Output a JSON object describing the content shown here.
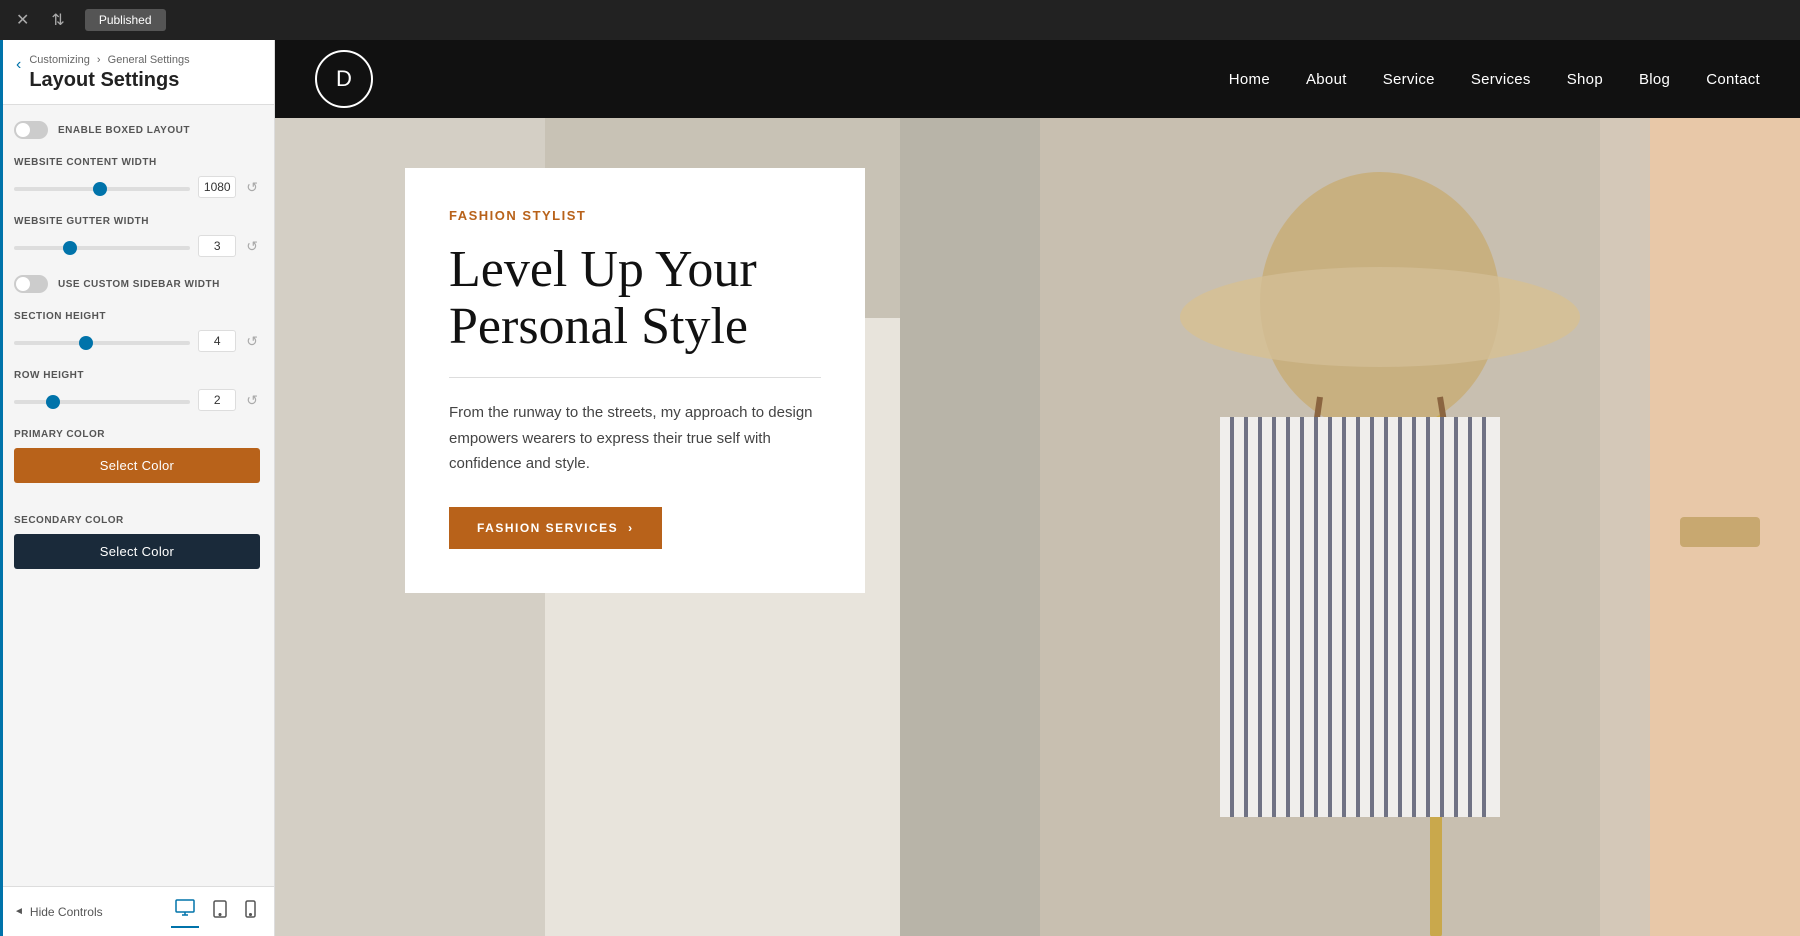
{
  "topbar": {
    "close_label": "✕",
    "arrows_label": "⇅",
    "published_label": "Published"
  },
  "sidebar": {
    "breadcrumb_parent": "Customizing",
    "breadcrumb_sep": "›",
    "breadcrumb_child": "General Settings",
    "title": "Layout Settings",
    "back_icon": "‹",
    "enable_boxed_label": "ENABLE BOXED LAYOUT",
    "content_width_label": "WEBSITE CONTENT WIDTH",
    "content_width_value": "1080",
    "gutter_width_label": "WEBSITE GUTTER WIDTH",
    "gutter_width_value": "3",
    "custom_sidebar_label": "USE CUSTOM SIDEBAR WIDTH",
    "section_height_label": "SECTION HEIGHT",
    "section_height_value": "4",
    "row_height_label": "ROW HEIGHT",
    "row_height_value": "2",
    "primary_color_label": "PRIMARY COLOR",
    "primary_color_btn": "Select Color",
    "secondary_color_label": "SECONDARY COLOR",
    "secondary_color_btn": "Select Color",
    "hide_controls_label": "Hide Controls",
    "reset_icon": "↺"
  },
  "navbar": {
    "logo_letter": "D",
    "items": [
      {
        "label": "Home"
      },
      {
        "label": "About"
      },
      {
        "label": "Service"
      },
      {
        "label": "Services"
      },
      {
        "label": "Shop"
      },
      {
        "label": "Blog"
      },
      {
        "label": "Contact"
      }
    ]
  },
  "hero": {
    "tag": "FASHION STYLIST",
    "title_line1": "Level Up Your",
    "title_line2": "Personal Style",
    "description": "From the runway to the streets, my approach to design empowers wearers to express their true self with confidence and style.",
    "cta_label": "FASHION SERVICES",
    "cta_arrow": "›"
  },
  "colors": {
    "primary": "#b8621a",
    "secondary": "#1a2a3a",
    "accent_blue": "#0073aa"
  }
}
